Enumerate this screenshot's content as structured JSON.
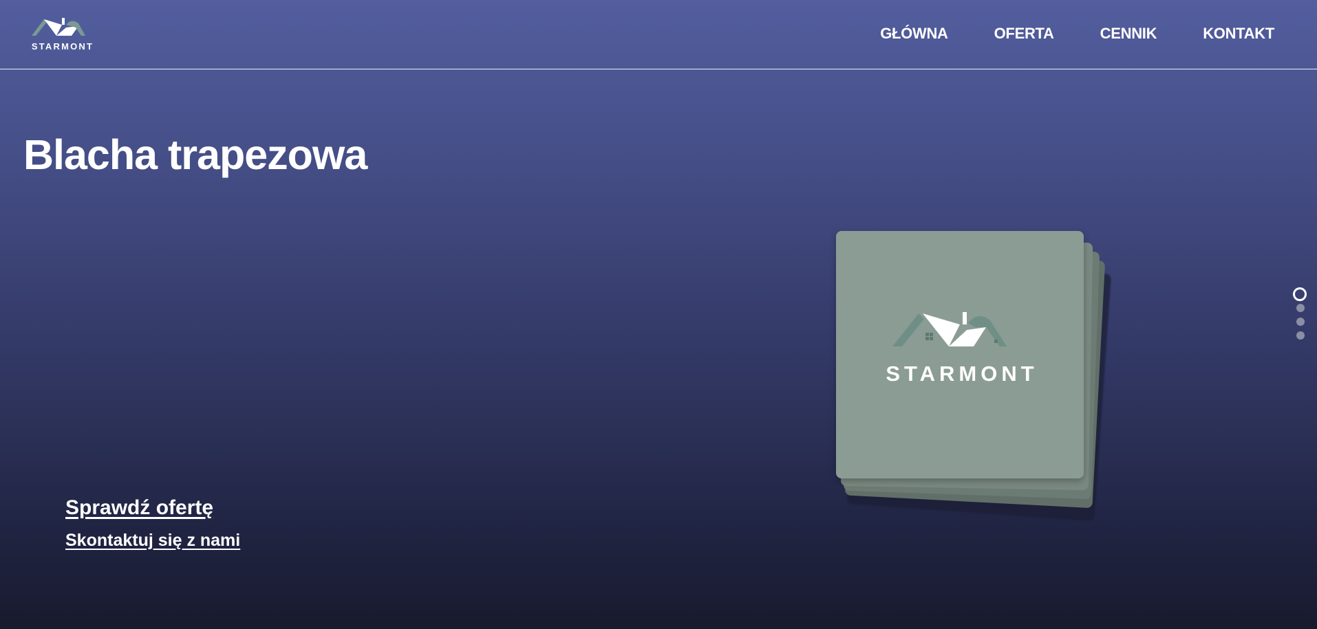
{
  "brand": {
    "name": "STARMONT",
    "logo_icon": "house-roof-logo"
  },
  "nav": {
    "items": [
      {
        "label": "GŁÓWNA"
      },
      {
        "label": "OFERTA"
      },
      {
        "label": "CENNIK"
      },
      {
        "label": "KONTAKT"
      }
    ]
  },
  "hero": {
    "title": "Blacha trapezowa",
    "primary_cta": "Sprawdź ofertę",
    "secondary_cta": "Skontaktuj się z nami"
  },
  "gallery": {
    "card_brand": "STARMONT",
    "card_icon": "house-roof-logo",
    "slide_count": 4,
    "active_slide": 1
  },
  "colors": {
    "header_bg": "#535e9f",
    "bottom_bg": "#181a2d",
    "card_bg": "#8b9c94",
    "logo_accent": "#6f8f86"
  }
}
